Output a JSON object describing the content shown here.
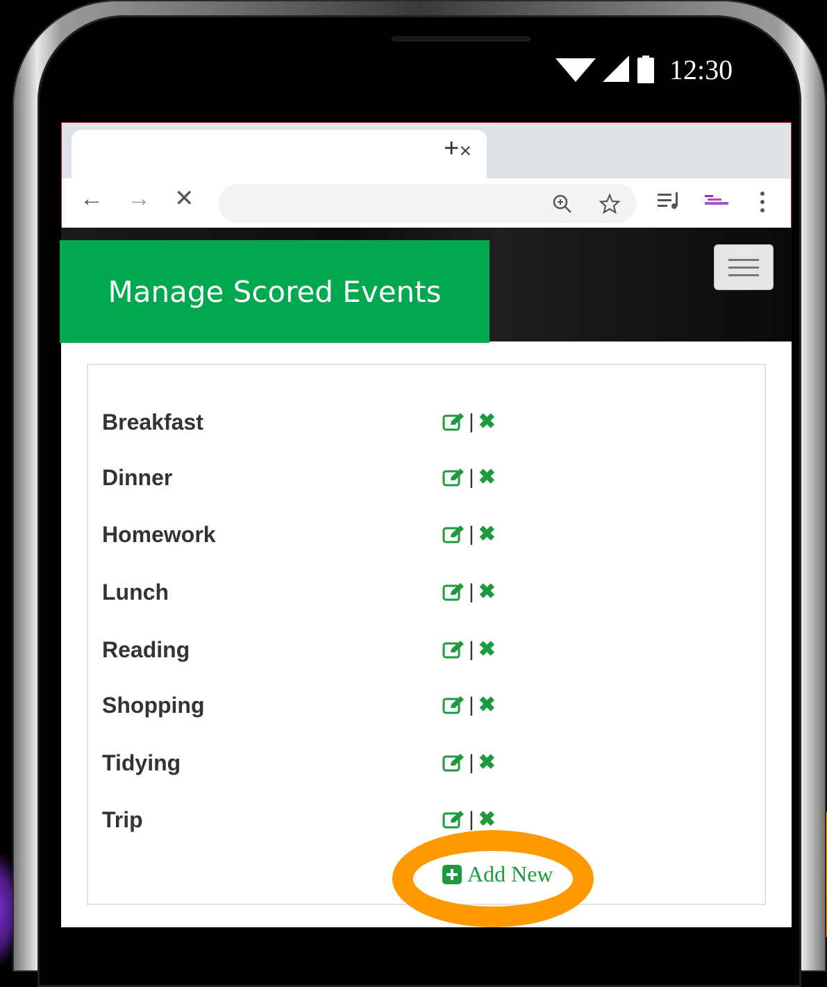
{
  "status_bar": {
    "time": "12:30",
    "icons": [
      "wifi-icon",
      "signal-icon",
      "battery-icon"
    ]
  },
  "browser": {
    "tab_close": "×",
    "new_tab": "+",
    "nav": {
      "back": "←",
      "forward": "→",
      "stop": "✕"
    },
    "omnibox_icons": [
      "zoom-icon",
      "star-icon"
    ],
    "toolbar_icons": [
      "playlist-icon",
      "extension-icon",
      "more-icon"
    ]
  },
  "page": {
    "title": "Manage Scored Events",
    "menu_icon": "hamburger-icon",
    "events": [
      {
        "name": "Breakfast"
      },
      {
        "name": "Dinner"
      },
      {
        "name": "Homework"
      },
      {
        "name": "Lunch"
      },
      {
        "name": "Reading"
      },
      {
        "name": "Shopping"
      },
      {
        "name": "Tidying"
      },
      {
        "name": "Trip"
      }
    ],
    "action_separator": "|",
    "delete_glyph": "✖",
    "add_new_label": "Add New"
  },
  "colors": {
    "brand_green": "#00a94f",
    "action_green": "#1e9a3e",
    "highlight_orange": "#ff9900"
  }
}
